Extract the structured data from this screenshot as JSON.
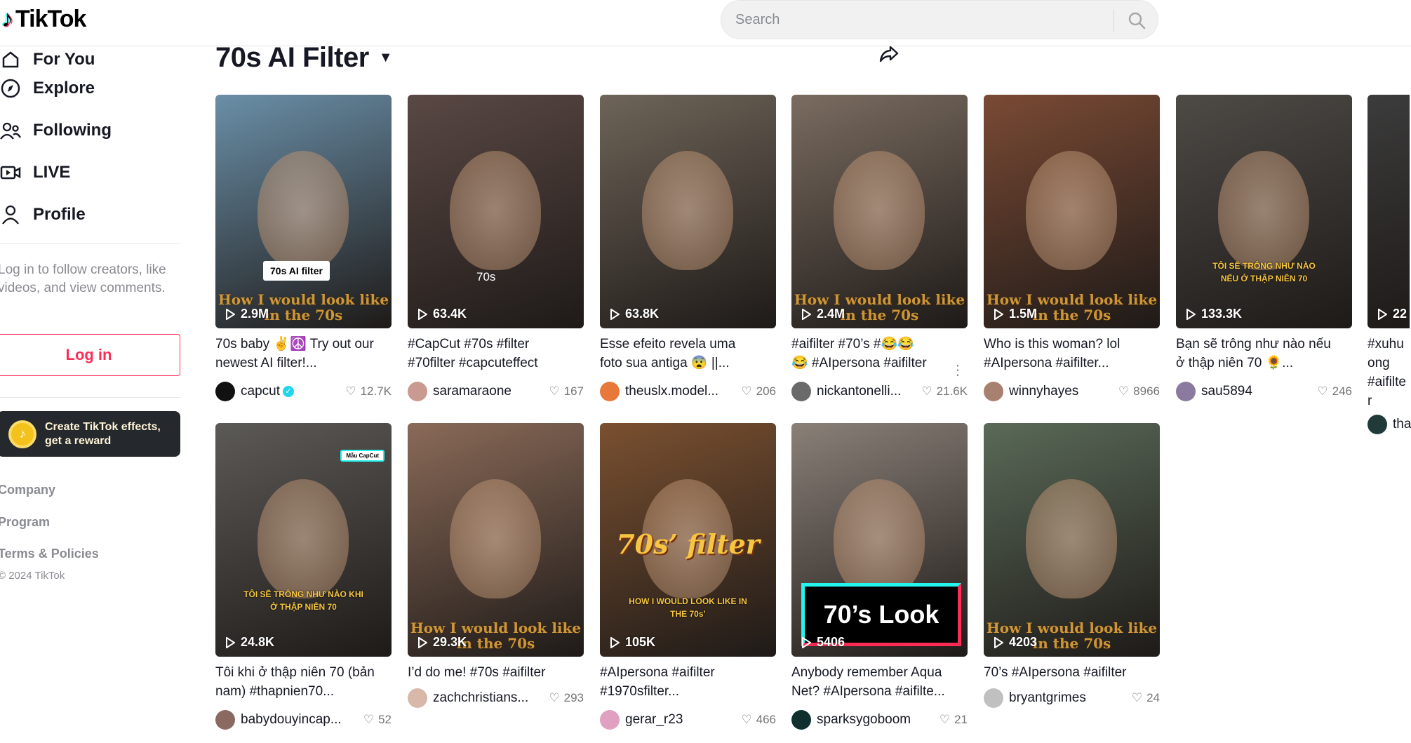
{
  "header": {
    "logo": "TikTok",
    "search_placeholder": "Search"
  },
  "sidebar": {
    "nav": [
      {
        "label": "For You",
        "icon": "home-icon"
      },
      {
        "label": "Explore",
        "icon": "compass-icon"
      },
      {
        "label": "Following",
        "icon": "following-icon"
      },
      {
        "label": "LIVE",
        "icon": "live-icon"
      },
      {
        "label": "Profile",
        "icon": "profile-icon"
      }
    ],
    "login_prompt": "Log in to follow creators, like videos, and view comments.",
    "login_button": "Log in",
    "promo": "Create TikTok effects, get a reward",
    "footer": [
      "Company",
      "Program",
      "Terms & Policies"
    ],
    "copyright": "© 2024 TikTok"
  },
  "main": {
    "title": "70s AI Filter",
    "accent": "#fe2c55",
    "videos": [
      {
        "views": "2.9M",
        "caption": "70s baby ✌️☮️ Try out our\nnewest AI filter!...",
        "author": "capcut",
        "verified": true,
        "likes": "12.7K",
        "overlay": "How I would look like in the 70s",
        "label": "70s AI filter",
        "thumb_color": "#6a8fa8"
      },
      {
        "views": "63.4K",
        "caption": "#CapCut #70s #filter\n#70filter #capcuteffect",
        "author": "saramaraone",
        "likes": "167",
        "label": "70s",
        "thumb_color": "#5a4844"
      },
      {
        "views": "63.8K",
        "caption": "Esse efeito revela uma\nfoto sua antiga 😨 ||...",
        "author": "theuslx.model...",
        "likes": "206",
        "thumb_color": "#6e6458"
      },
      {
        "views": "2.4M",
        "caption": "#aifilter #70’s #😂😂\n😂 #AIpersona #aifilter",
        "author": "nickantonelli...",
        "likes": "21.6K",
        "overlay": "How I would look like in the 70s",
        "more": true,
        "thumb_color": "#7a6c60"
      },
      {
        "views": "1.5M",
        "caption": "Who is this woman? lol\n#AIpersona #aifilter...",
        "author": "winnyhayes",
        "likes": "8966",
        "overlay": "How I would look like in the 70s",
        "thumb_color": "#7a4a34"
      },
      {
        "views": "133.3K",
        "caption": "Bạn sẽ trông như nào nếu\nở thập niên 70 🌻...",
        "author": "sau5894",
        "likes": "246",
        "overlay_vn": "TÔI SẼ TRÔNG NHƯ NÀO NẾU Ở THẬP NIÊN 70",
        "thumb_color": "#4e4a46"
      },
      {
        "views": "22",
        "caption": "#xuhuong\n#aifilter",
        "author": "tha",
        "likes": "",
        "thumb_color": "#3c3c3c"
      },
      {
        "views": "24.8K",
        "caption": "Tôi khi ở thập niên 70 (bản\nnam) #thapnien70...",
        "author": "babydouyincap...",
        "likes": "52",
        "overlay_vn": "TÔI SẼ TRÔNG NHƯ NÀO KHI Ở THẬP NIÊN 70",
        "label": "Mẫu CapCut",
        "thumb_color": "#5c5a56"
      },
      {
        "views": "29.3K",
        "caption": "I’d do me! #70s #aifilter",
        "author": "zachchristians...",
        "likes": "293",
        "overlay": "How I would look like in the 70s",
        "thumb_color": "#8a6a58"
      },
      {
        "views": "105K",
        "caption": "#AIpersona #aifilter\n#1970sfilter...",
        "author": "gerar_r23",
        "likes": "466",
        "big": "70s’ filter",
        "overlay_vn": "HOW I WOULD LOOK LIKE IN THE 70s’",
        "thumb_color": "#7a5030"
      },
      {
        "views": "5406",
        "caption": "Anybody remember Aqua\nNet? #AIpersona #aifilte...",
        "author": "sparksygoboom",
        "likes": "21",
        "big_box": "70’s Look",
        "thumb_color": "#8a8078"
      },
      {
        "views": "4203",
        "caption": "70’s #AIpersona #aifilter",
        "author": "bryantgrimes",
        "likes": "24",
        "overlay": "How I would look like in the 70s",
        "thumb_color": "#5a6a58"
      }
    ]
  }
}
